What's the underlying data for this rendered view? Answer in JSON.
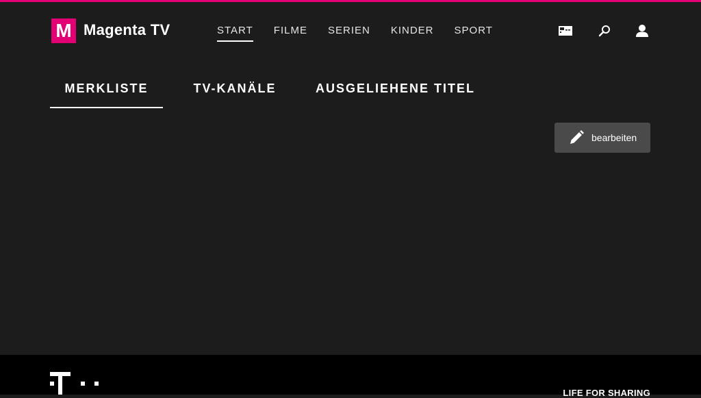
{
  "colors": {
    "brand": "#e20074",
    "background": "#1c1c1c",
    "button": "#4a4a4a",
    "footer": "#000000"
  },
  "header": {
    "logo_letter": "M",
    "title": "Magenta TV",
    "nav": [
      {
        "label": "START",
        "active": true
      },
      {
        "label": "FILME",
        "active": false
      },
      {
        "label": "SERIEN",
        "active": false
      },
      {
        "label": "KINDER",
        "active": false
      },
      {
        "label": "SPORT",
        "active": false
      }
    ],
    "icons": [
      "remote-icon",
      "search-icon",
      "user-icon"
    ]
  },
  "tabs": [
    {
      "label": "MERKLISTE",
      "active": true
    },
    {
      "label": "TV-KANÄLE",
      "active": false
    },
    {
      "label": "AUSGELIEHENE TITEL",
      "active": false
    }
  ],
  "edit_button": {
    "label": "bearbeiten",
    "icon": "pencil-icon"
  },
  "footer": {
    "logo": "telekom-logo",
    "slogan": "LIFE FOR SHARING"
  }
}
